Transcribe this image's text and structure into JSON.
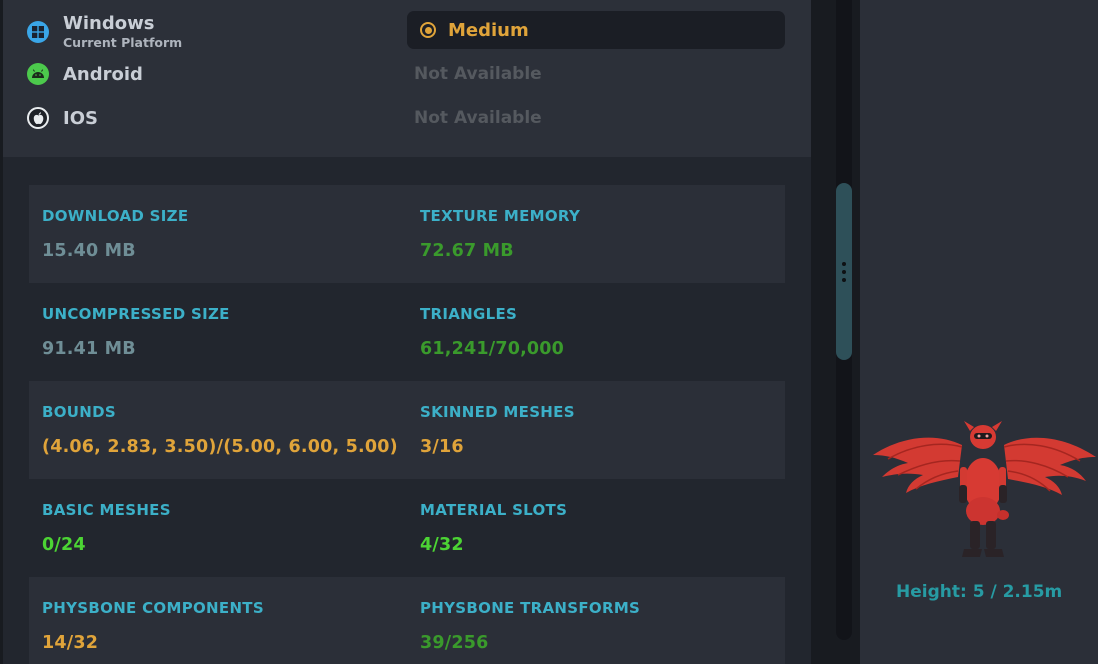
{
  "platforms": [
    {
      "name": "Windows",
      "subtitle": "Current Platform",
      "icon": "windows-icon",
      "color": "#3aa6e8",
      "performance": "Medium"
    },
    {
      "name": "Android",
      "subtitle": "",
      "icon": "android-icon",
      "color": "#4cc94c",
      "performance": "Not Available"
    },
    {
      "name": "IOS",
      "subtitle": "",
      "icon": "apple-icon",
      "color": "#e9ecef",
      "performance": "Not Available"
    }
  ],
  "stats": [
    {
      "left": {
        "label": "DOWNLOAD SIZE",
        "value": "15.40 MB",
        "color": "#6f8e96"
      },
      "right": {
        "label": "TEXTURE MEMORY",
        "value": "72.67 MB",
        "color": "#3a9a2c"
      }
    },
    {
      "left": {
        "label": "UNCOMPRESSED SIZE",
        "value": "91.41 MB",
        "color": "#6f8e96"
      },
      "right": {
        "label": "TRIANGLES",
        "value": "61,241/70,000",
        "color": "#3a9a2c"
      }
    },
    {
      "left": {
        "label": "BOUNDS",
        "value": "(4.06, 2.83, 3.50)/(5.00, 6.00, 5.00)",
        "color": "#e0a43a"
      },
      "right": {
        "label": "SKINNED MESHES",
        "value": "3/16",
        "color": "#e0a43a"
      }
    },
    {
      "left": {
        "label": "BASIC MESHES",
        "value": "0/24",
        "color": "#4cd434"
      },
      "right": {
        "label": "MATERIAL SLOTS",
        "value": "4/32",
        "color": "#4cd434"
      }
    },
    {
      "left": {
        "label": "PHYSBONE COMPONENTS",
        "value": "14/32",
        "color": "#e0a43a"
      },
      "right": {
        "label": "PHYSBONE TRANSFORMS",
        "value": "39/256",
        "color": "#3a9a2c"
      }
    }
  ],
  "preview": {
    "height_label": "Height: 5 / 2.15m"
  },
  "colors": {
    "accent_label": "#3cb0c8",
    "medium_orange": "#e0a43a"
  }
}
